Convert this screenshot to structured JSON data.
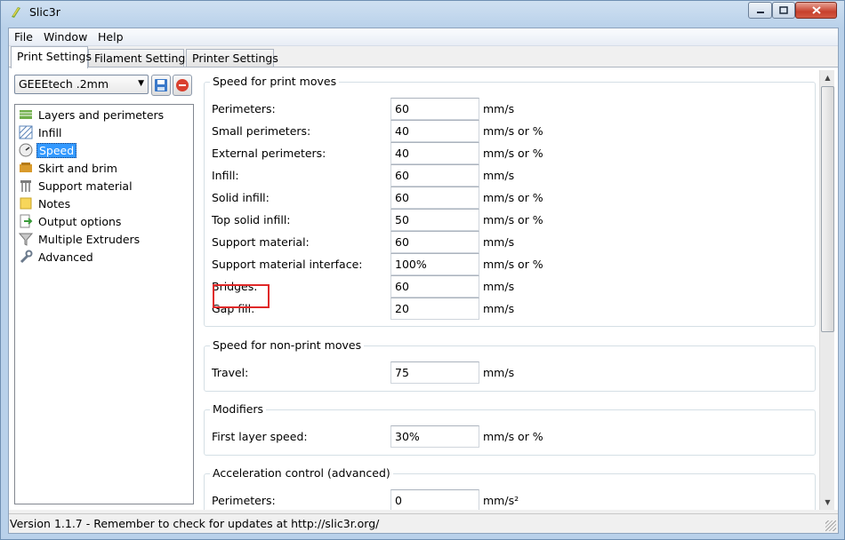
{
  "window": {
    "title": "Slic3r"
  },
  "menu": [
    "File",
    "Window",
    "Help"
  ],
  "tabs": [
    "Print Settings",
    "Filament Settings",
    "Printer Settings"
  ],
  "preset": {
    "selected": "GEEEtech .2mm"
  },
  "tree": [
    {
      "label": "Layers and perimeters",
      "icon": "layers-icon"
    },
    {
      "label": "Infill",
      "icon": "infill-icon"
    },
    {
      "label": "Speed",
      "icon": "speedometer-icon",
      "selected": true
    },
    {
      "label": "Skirt and brim",
      "icon": "skirt-icon"
    },
    {
      "label": "Support material",
      "icon": "support-icon"
    },
    {
      "label": "Notes",
      "icon": "note-icon"
    },
    {
      "label": "Output options",
      "icon": "output-icon"
    },
    {
      "label": "Multiple Extruders",
      "icon": "funnel-icon"
    },
    {
      "label": "Advanced",
      "icon": "wrench-icon"
    }
  ],
  "groups": {
    "print_moves": {
      "title": "Speed for print moves",
      "rows": [
        {
          "label": "Perimeters:",
          "value": "60",
          "unit": "mm/s"
        },
        {
          "label": "Small perimeters:",
          "value": "40",
          "unit": "mm/s or %"
        },
        {
          "label": "External perimeters:",
          "value": "40",
          "unit": "mm/s or %"
        },
        {
          "label": "Infill:",
          "value": "60",
          "unit": "mm/s"
        },
        {
          "label": "Solid infill:",
          "value": "60",
          "unit": "mm/s or %"
        },
        {
          "label": "Top solid infill:",
          "value": "50",
          "unit": "mm/s or %"
        },
        {
          "label": "Support material:",
          "value": "60",
          "unit": "mm/s"
        },
        {
          "label": "Support material interface:",
          "value": "100%",
          "unit": "mm/s or %"
        },
        {
          "label": "Bridges:",
          "value": "60",
          "unit": "mm/s"
        },
        {
          "label": "Gap fill:",
          "value": "20",
          "unit": "mm/s"
        }
      ]
    },
    "non_print_moves": {
      "title": "Speed for non-print moves",
      "rows": [
        {
          "label": "Travel:",
          "value": "75",
          "unit": "mm/s"
        }
      ]
    },
    "modifiers": {
      "title": "Modifiers",
      "rows": [
        {
          "label": "First layer speed:",
          "value": "30%",
          "unit": "mm/s or %"
        }
      ]
    },
    "acceleration": {
      "title": "Acceleration control (advanced)",
      "rows": [
        {
          "label": "Perimeters:",
          "value": "0",
          "unit": "mm/s²"
        }
      ]
    }
  },
  "status": "Version 1.1.7 - Remember to check for updates at http://slic3r.org/",
  "colors": {
    "selection": "#3399ff",
    "highlight": "#e02828"
  }
}
